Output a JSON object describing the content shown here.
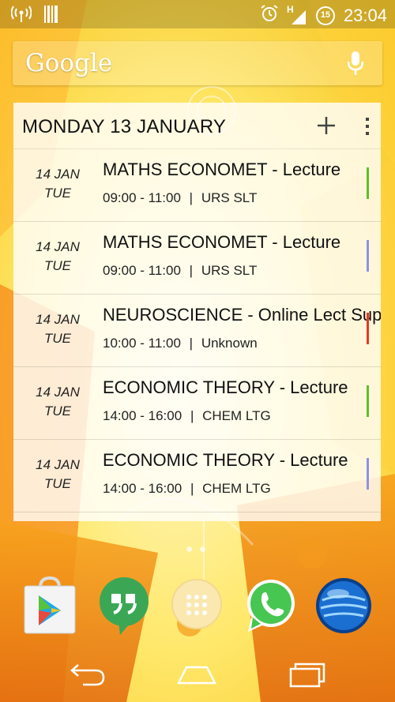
{
  "status_bar": {
    "time": "23:04",
    "network_type": "H",
    "battery_level": "15",
    "icons": [
      "wifi-hotspot-icon",
      "barcode-icon",
      "alarm-icon",
      "signal-icon",
      "battery-icon"
    ]
  },
  "search": {
    "logo": "Google",
    "mic_icon": "microphone-icon"
  },
  "widget": {
    "title": "MONDAY 13 JANUARY",
    "add_icon": "plus-icon",
    "menu_icon": "overflow-menu-icon",
    "events": [
      {
        "date": "14 JAN",
        "day": "TUE",
        "title": "MATHS ECONOMET - Lecture",
        "time": "09:00 - 11:00",
        "separator": "|",
        "location": "URS SLT",
        "color": "#5fbf2f"
      },
      {
        "date": "14 JAN",
        "day": "TUE",
        "title": "MATHS ECONOMET - Lecture",
        "time": "09:00 - 11:00",
        "separator": "|",
        "location": "URS SLT",
        "color": "#8f90e8"
      },
      {
        "date": "14 JAN",
        "day": "TUE",
        "title": "NEUROSCIENCE - Online Lect Sup",
        "time": "10:00 - 11:00",
        "separator": "|",
        "location": "Unknown",
        "color": "#e23b1f"
      },
      {
        "date": "14 JAN",
        "day": "TUE",
        "title": "ECONOMIC THEORY - Lecture",
        "time": "14:00 - 16:00",
        "separator": "|",
        "location": "CHEM LTG",
        "color": "#5fbf2f"
      },
      {
        "date": "14 JAN",
        "day": "TUE",
        "title": "ECONOMIC THEORY - Lecture",
        "time": "14:00 - 16:00",
        "separator": "|",
        "location": "CHEM LTG",
        "color": "#8f90e8"
      }
    ]
  },
  "dock": {
    "apps": [
      "play-store-icon",
      "hangouts-icon",
      "app-drawer-icon",
      "whatsapp-icon",
      "globe-icon"
    ]
  },
  "nav": {
    "buttons": [
      "back-icon",
      "home-icon",
      "recent-apps-icon"
    ]
  }
}
